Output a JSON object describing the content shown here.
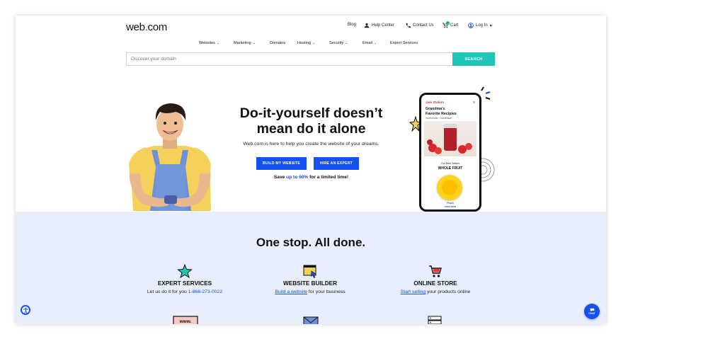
{
  "header": {
    "logo_text": "web",
    "logo_dot": ".",
    "logo_suffix": "com",
    "utility": {
      "blog": "Blog",
      "help_center": "Help Center",
      "contact_us": "Contact Us",
      "cart": "Cart",
      "log_in": "Log In"
    }
  },
  "nav": {
    "items": [
      {
        "label": "Websites",
        "has_dropdown": true
      },
      {
        "label": "Marketing",
        "has_dropdown": true
      },
      {
        "label": "Domains",
        "has_dropdown": false
      },
      {
        "label": "Hosting",
        "has_dropdown": true
      },
      {
        "label": "Security",
        "has_dropdown": true
      },
      {
        "label": "Email",
        "has_dropdown": true
      },
      {
        "label": "Expert Services",
        "has_dropdown": false
      }
    ]
  },
  "search": {
    "placeholder": "Discover your domain",
    "button_label": "SEARCH"
  },
  "hero": {
    "title_line1": "Do-it-yourself doesn’t",
    "title_line2": "mean do it alone",
    "subtitle": "Web.com is here to help you create the website of your dreams.",
    "build_button": "BUILD MY WEBSITE",
    "expert_button": "HIRE AN EXPERT",
    "save_prefix": "Save ",
    "save_accent": "up to 60%",
    "save_suffix": " for a limited time!"
  },
  "phone": {
    "brand": "Jam Station",
    "recipe_title_line1": "Grandma's",
    "recipe_title_line2": "Favorite Recipies",
    "recipe_sub": "Homemade · Handmade",
    "best_sellers": "Our Best Sellers",
    "product_title": "WHOLE FRUIT",
    "product_name": "Peach",
    "shop_now": "SHOP NOW"
  },
  "lower": {
    "title": "One stop. All done.",
    "features": [
      {
        "title": "EXPERT SERVICES",
        "desc_prefix": "Let us do it for you ",
        "link": "1-866-273-0022",
        "desc_suffix": ""
      },
      {
        "title": "WEBSITE BUILDER",
        "desc_prefix": "",
        "link": "Build a website",
        "desc_suffix": " for your business"
      },
      {
        "title": "ONLINE STORE",
        "desc_prefix": "",
        "link": "Start selling",
        "desc_suffix": " your products online"
      }
    ]
  },
  "widgets": {
    "chat_label": "CHAT"
  },
  "colors": {
    "primary": "#1550f0",
    "search_button": "#1ec6b3",
    "lower_bg": "#e8eefc"
  }
}
